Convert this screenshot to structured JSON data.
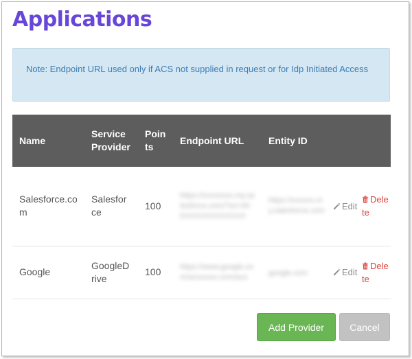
{
  "page": {
    "title": "Applications"
  },
  "note": {
    "text": "Note: Endpoint URL used only if ACS not supplied in request or for Idp Initiated Access"
  },
  "table": {
    "headers": {
      "name": "Name",
      "service_provider": "Service Provider",
      "points": "Points",
      "endpoint_url": "Endpoint URL",
      "entity_id": "Entity ID"
    },
    "rows": [
      {
        "name": "Salesforce.com",
        "service_provider": "Salesforce",
        "points": "100",
        "endpoint_url": "https://xxxxxxxx.my.salesforce.com/?so=00DXXXXXXXXXXXX",
        "entity_id": "https://xxxxxx.my.salesforce.com",
        "edit_label": "Edit",
        "delete_label": "Delete"
      },
      {
        "name": "Google",
        "service_provider": "GoogleDrive",
        "points": "100",
        "endpoint_url": "https://www.google.com/a/xxxxxx.com/acs",
        "entity_id": "google.com",
        "edit_label": "Edit",
        "delete_label": "Delete"
      }
    ]
  },
  "buttons": {
    "add_provider": "Add Provider",
    "cancel": "Cancel"
  },
  "colors": {
    "title": "#6847d8",
    "note_bg": "#d4e7f2",
    "note_text": "#3c7db5",
    "table_header_bg": "#5d5d5d",
    "add_button": "#6ab655",
    "cancel_button": "#c2c2c2",
    "delete_red": "#d9443f"
  },
  "icons": {
    "edit": "pencil-icon",
    "delete": "trash-icon"
  }
}
